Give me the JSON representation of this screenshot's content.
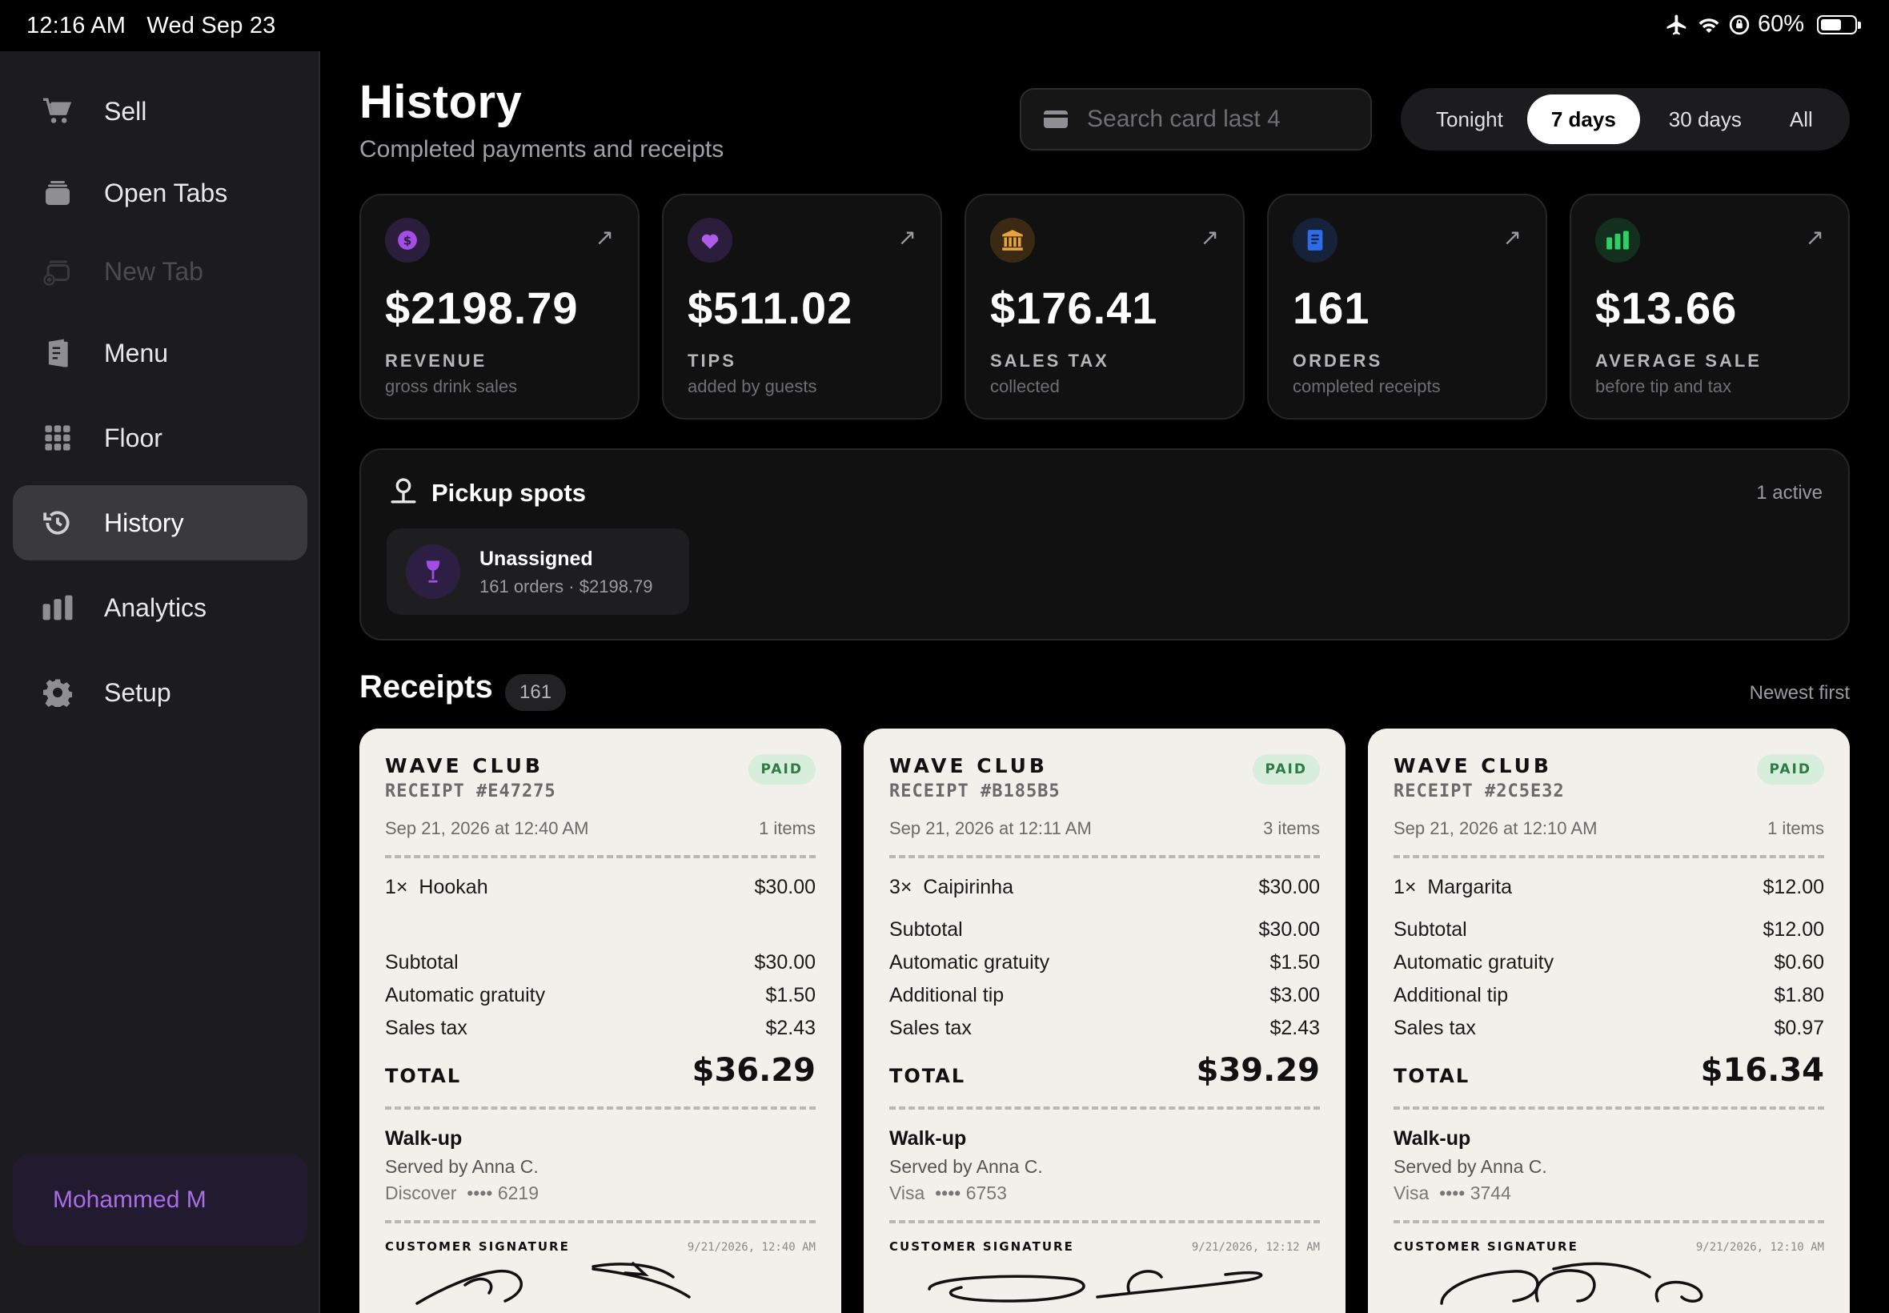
{
  "status_bar": {
    "time": "12:16 AM",
    "date": "Wed Sep 23",
    "battery": "60%",
    "battery_level": 0.6
  },
  "sidebar": {
    "items": [
      {
        "label": "Sell",
        "icon": "cart-icon"
      },
      {
        "label": "Open Tabs",
        "icon": "tabs-stack-icon"
      },
      {
        "label": "New Tab",
        "icon": "new-tab-icon",
        "disabled": true
      },
      {
        "label": "Menu",
        "icon": "menu-book-icon"
      },
      {
        "label": "Floor",
        "icon": "grid-icon"
      },
      {
        "label": "History",
        "icon": "history-clock-icon",
        "active": true
      },
      {
        "label": "Analytics",
        "icon": "bar-chart-icon"
      },
      {
        "label": "Setup",
        "icon": "gear-icon"
      }
    ],
    "user": "Mohammed M"
  },
  "header": {
    "title": "History",
    "subtitle": "Completed payments and receipts",
    "search_placeholder": "Search card last 4",
    "ranges": [
      "Tonight",
      "7 days",
      "30 days",
      "All"
    ],
    "active_range": "7 days"
  },
  "stats": [
    {
      "value": "$2198.79",
      "label": "REVENUE",
      "sub": "gross drink sales",
      "icon": "dollar-icon",
      "color": "#a34de6",
      "bg": "#2b1d3c"
    },
    {
      "value": "$511.02",
      "label": "TIPS",
      "sub": "added by guests",
      "icon": "heart-icon",
      "color": "#b05be8",
      "bg": "#2b1d3c"
    },
    {
      "value": "$176.41",
      "label": "SALES TAX",
      "sub": "collected",
      "icon": "bank-icon",
      "color": "#e8a33a",
      "bg": "#3a2a14"
    },
    {
      "value": "161",
      "label": "ORDERS",
      "sub": "completed receipts",
      "icon": "receipt-icon",
      "color": "#2e6be6",
      "bg": "#16213a"
    },
    {
      "value": "$13.66",
      "label": "AVERAGE SALE",
      "sub": "before tip and tax",
      "icon": "bar-chart-icon",
      "color": "#2fcf66",
      "bg": "#13301f"
    }
  ],
  "pickup": {
    "title": "Pickup spots",
    "active": "1 active",
    "spot": {
      "name": "Unassigned",
      "orders": "161 orders",
      "amount": "$2198.79"
    }
  },
  "receipts_header": {
    "title": "Receipts",
    "count": "161",
    "sort": "Newest first"
  },
  "receipts": [
    {
      "brand": "WAVE CLUB",
      "id": "RECEIPT #E47275",
      "status": "PAID",
      "date": "Sep 21, 2026 at 12:40 AM",
      "items_count": "1 items",
      "lines": [
        {
          "qty": "1×",
          "name": "Hookah",
          "price": "$30.00"
        }
      ],
      "summary": [
        {
          "label": "Subtotal",
          "value": "$30.00"
        },
        {
          "label": "Automatic gratuity",
          "value": "$1.50"
        },
        {
          "label": "Sales tax",
          "value": "$2.43"
        }
      ],
      "total_label": "TOTAL",
      "total": "$36.29",
      "order_type": "Walk-up",
      "served_by": "Served by Anna C.",
      "card_brand": "Discover",
      "card_last4": "•••• 6219",
      "signature_label": "CUSTOMER SIGNATURE",
      "signature_time": "9/21/2026, 12:40 AM"
    },
    {
      "brand": "WAVE CLUB",
      "id": "RECEIPT #B185B5",
      "status": "PAID",
      "date": "Sep 21, 2026 at 12:11 AM",
      "items_count": "3 items",
      "lines": [
        {
          "qty": "3×",
          "name": "Caipirinha",
          "price": "$30.00"
        }
      ],
      "summary": [
        {
          "label": "Subtotal",
          "value": "$30.00"
        },
        {
          "label": "Automatic gratuity",
          "value": "$1.50"
        },
        {
          "label": "Additional tip",
          "value": "$3.00"
        },
        {
          "label": "Sales tax",
          "value": "$2.43"
        }
      ],
      "total_label": "TOTAL",
      "total": "$39.29",
      "order_type": "Walk-up",
      "served_by": "Served by Anna C.",
      "card_brand": "Visa",
      "card_last4": "•••• 6753",
      "signature_label": "CUSTOMER SIGNATURE",
      "signature_time": "9/21/2026, 12:12 AM"
    },
    {
      "brand": "WAVE CLUB",
      "id": "RECEIPT #2C5E32",
      "status": "PAID",
      "date": "Sep 21, 2026 at 12:10 AM",
      "items_count": "1 items",
      "lines": [
        {
          "qty": "1×",
          "name": "Margarita",
          "price": "$12.00"
        }
      ],
      "summary": [
        {
          "label": "Subtotal",
          "value": "$12.00"
        },
        {
          "label": "Automatic gratuity",
          "value": "$0.60"
        },
        {
          "label": "Additional tip",
          "value": "$1.80"
        },
        {
          "label": "Sales tax",
          "value": "$0.97"
        }
      ],
      "total_label": "TOTAL",
      "total": "$16.34",
      "order_type": "Walk-up",
      "served_by": "Served by Anna C.",
      "card_brand": "Visa",
      "card_last4": "•••• 3744",
      "signature_label": "CUSTOMER SIGNATURE",
      "signature_time": "9/21/2026, 12:10 AM"
    }
  ]
}
